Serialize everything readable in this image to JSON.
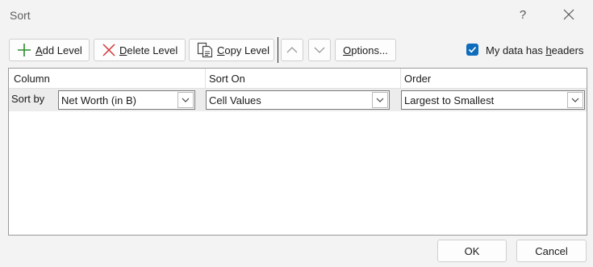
{
  "dialog": {
    "title": "Sort",
    "help_glyph": "?"
  },
  "toolbar": {
    "add_level": {
      "mnemonic": "A",
      "rest": "dd Level",
      "icon": "plus-icon"
    },
    "delete_level": {
      "mnemonic": "D",
      "rest": "elete Level",
      "icon": "close-icon"
    },
    "copy_level": {
      "mnemonic": "C",
      "rest": "opy Level",
      "icon": "copy-icon"
    },
    "options": {
      "mnemonic": "O",
      "rest": "ptions..."
    },
    "move_up_icon": "chevron-up-icon",
    "move_down_icon": "chevron-down-icon"
  },
  "headers_option": {
    "label_pre": "My data has ",
    "mnemonic": "h",
    "label_post": "eaders",
    "checked": true
  },
  "grid": {
    "column_header": "Column",
    "sort_on_header": "Sort On",
    "order_header": "Order",
    "rows": [
      {
        "label": "Sort by",
        "column": "Net Worth (in B)",
        "sort_on": "Cell Values",
        "order": "Largest to Smallest"
      }
    ]
  },
  "footer": {
    "ok": "OK",
    "cancel": "Cancel"
  },
  "colors": {
    "accent": "#0f6cbd",
    "add_icon": "#2e8b2e",
    "delete_icon": "#d13438"
  }
}
